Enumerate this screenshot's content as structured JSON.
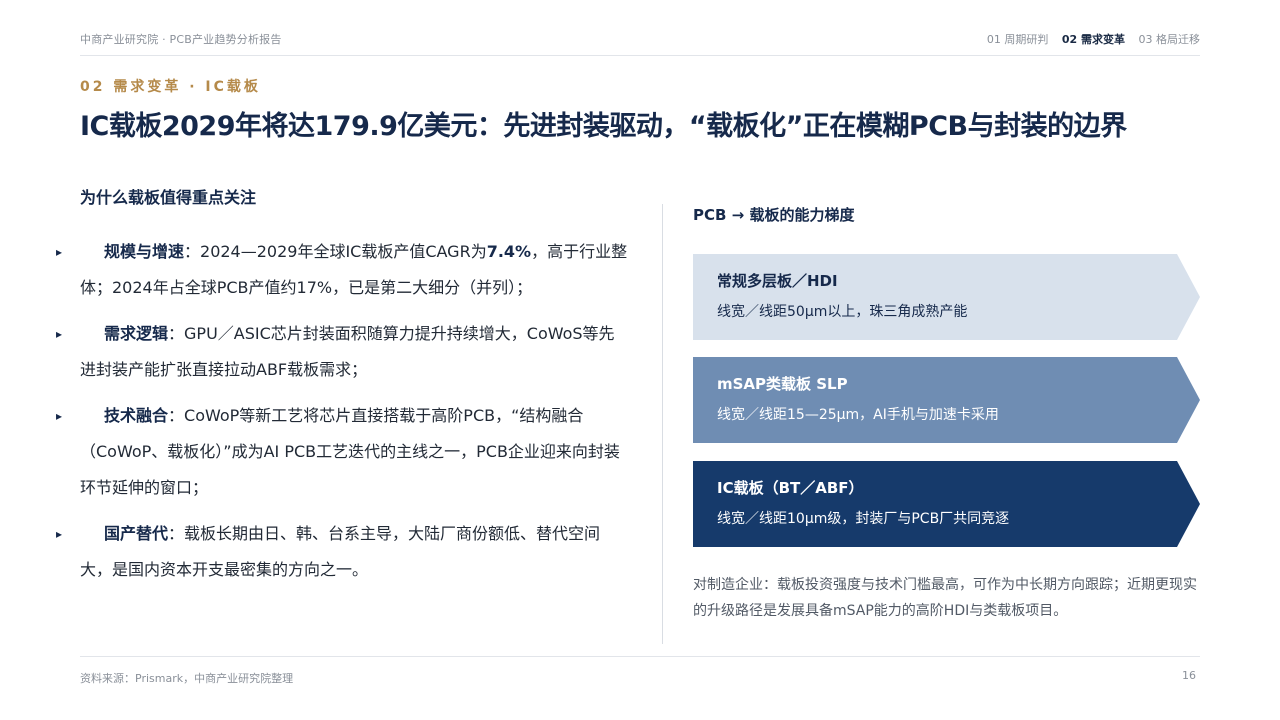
{
  "header": {
    "org": "中商产业研究院 · PCB产业趋势分析报告",
    "nav": [
      "01 周期研判",
      "02 需求变革",
      "03 格局迁移"
    ],
    "active_nav": "02 需求变革"
  },
  "section_tag": "02 需求变革 · IC载板",
  "title": "IC载板2029年将达179.9亿美元：先进封装驱动，“载板化”正在模糊PCB与封装的边界",
  "left": {
    "heading": "为什么载板值得重点关注",
    "bullets": [
      {
        "key": "规模与增速",
        "pre": "：2024—2029年全球IC载板产值CAGR为",
        "highlight": "7.4%",
        "post": "，高于行业整体；2024年占全球PCB产值约17%，已是第二大细分（并列）；"
      },
      {
        "key": "需求逻辑",
        "pre": "：GPU／ASIC芯片封装面积随算力提升持续增大，CoWoS等先进封装产能扩张直接拉动ABF载板需求；",
        "highlight": "",
        "post": ""
      },
      {
        "key": "技术融合",
        "pre": "：CoWoP等新工艺将芯片直接搭载于高阶PCB，“结构融合（CoWoP、载板化）”成为AI PCB工艺迭代的主线之一，PCB企业迎来向封装环节延伸的窗口；",
        "highlight": "",
        "post": ""
      },
      {
        "key": "国产替代",
        "pre": "：载板长期由日、韩、台系主导，大陆厂商份额低、替代空间大，是国内资本开支最密集的方向之一。",
        "highlight": "",
        "post": ""
      }
    ]
  },
  "right": {
    "heading": "PCB → 载板的能力梯度",
    "tiers": [
      {
        "name": "常规多层板／HDI",
        "desc": "线宽／线距50μm以上，珠三角成熟产能",
        "color": "#d8e1ec"
      },
      {
        "name": "mSAP类载板 SLP",
        "desc": "线宽／线距15—25μm，AI手机与加速卡采用",
        "color": "#6f8db3"
      },
      {
        "name": "IC载板（BT／ABF）",
        "desc": "线宽／线距10μm级，封装厂与PCB厂共同竞逐",
        "color": "#163a6b"
      }
    ],
    "note": "对制造企业：载板投资强度与技术门槛最高，可作为中长期方向跟踪；近期更现实的升级路径是发展具备mSAP能力的高阶HDI与类载板项目。"
  },
  "footer": {
    "source": "资料来源：Prismark，中商产业研究院整理",
    "page": "16"
  }
}
